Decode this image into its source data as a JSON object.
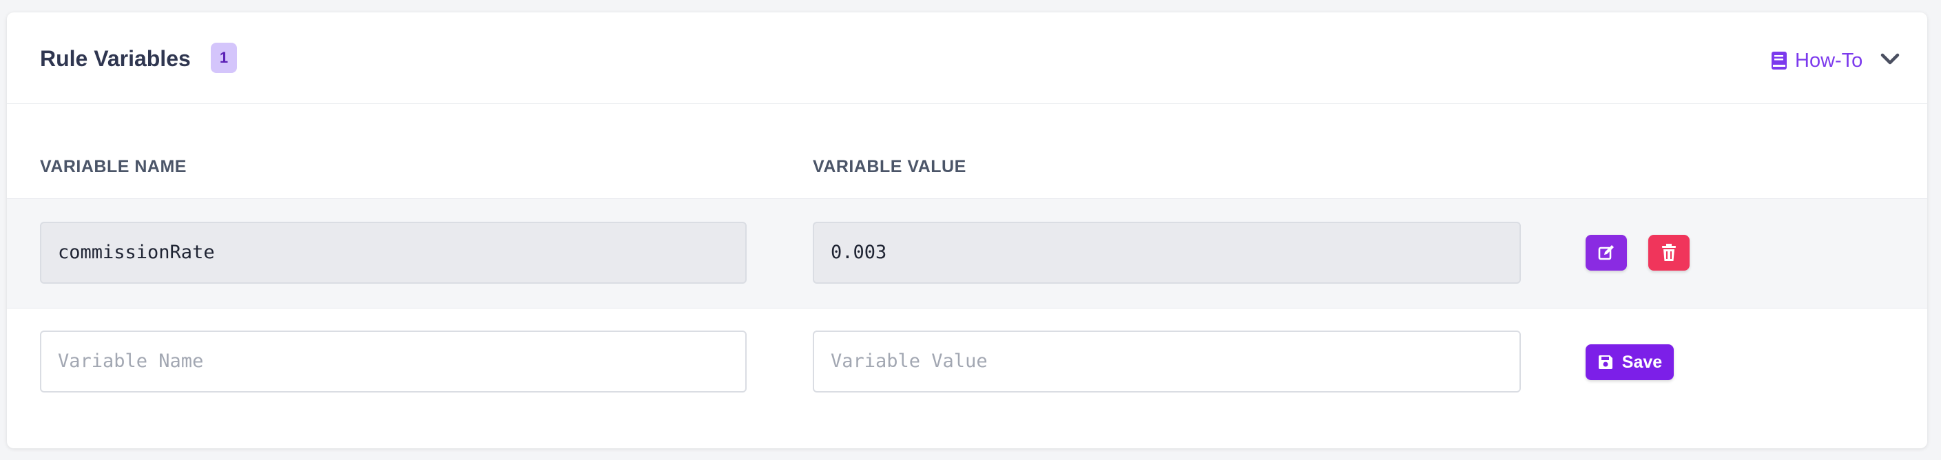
{
  "panel": {
    "title": "Rule Variables",
    "count_badge": "1",
    "howto_label": "How-To"
  },
  "table": {
    "columns": [
      "VARIABLE NAME",
      "VARIABLE VALUE"
    ],
    "rows": [
      {
        "name": "commissionRate",
        "value": "0.003"
      }
    ]
  },
  "new_row": {
    "name_placeholder": "Variable Name",
    "value_placeholder": "Variable Value",
    "save_label": "Save"
  },
  "icons": {
    "howto": "book-icon",
    "collapse": "chevron-down-icon",
    "edit": "edit-icon",
    "delete": "trash-icon",
    "save": "save-icon"
  },
  "colors": {
    "accent": "#7c1fe8",
    "danger": "#f0355b",
    "badge_bg": "#d4c5fb"
  }
}
